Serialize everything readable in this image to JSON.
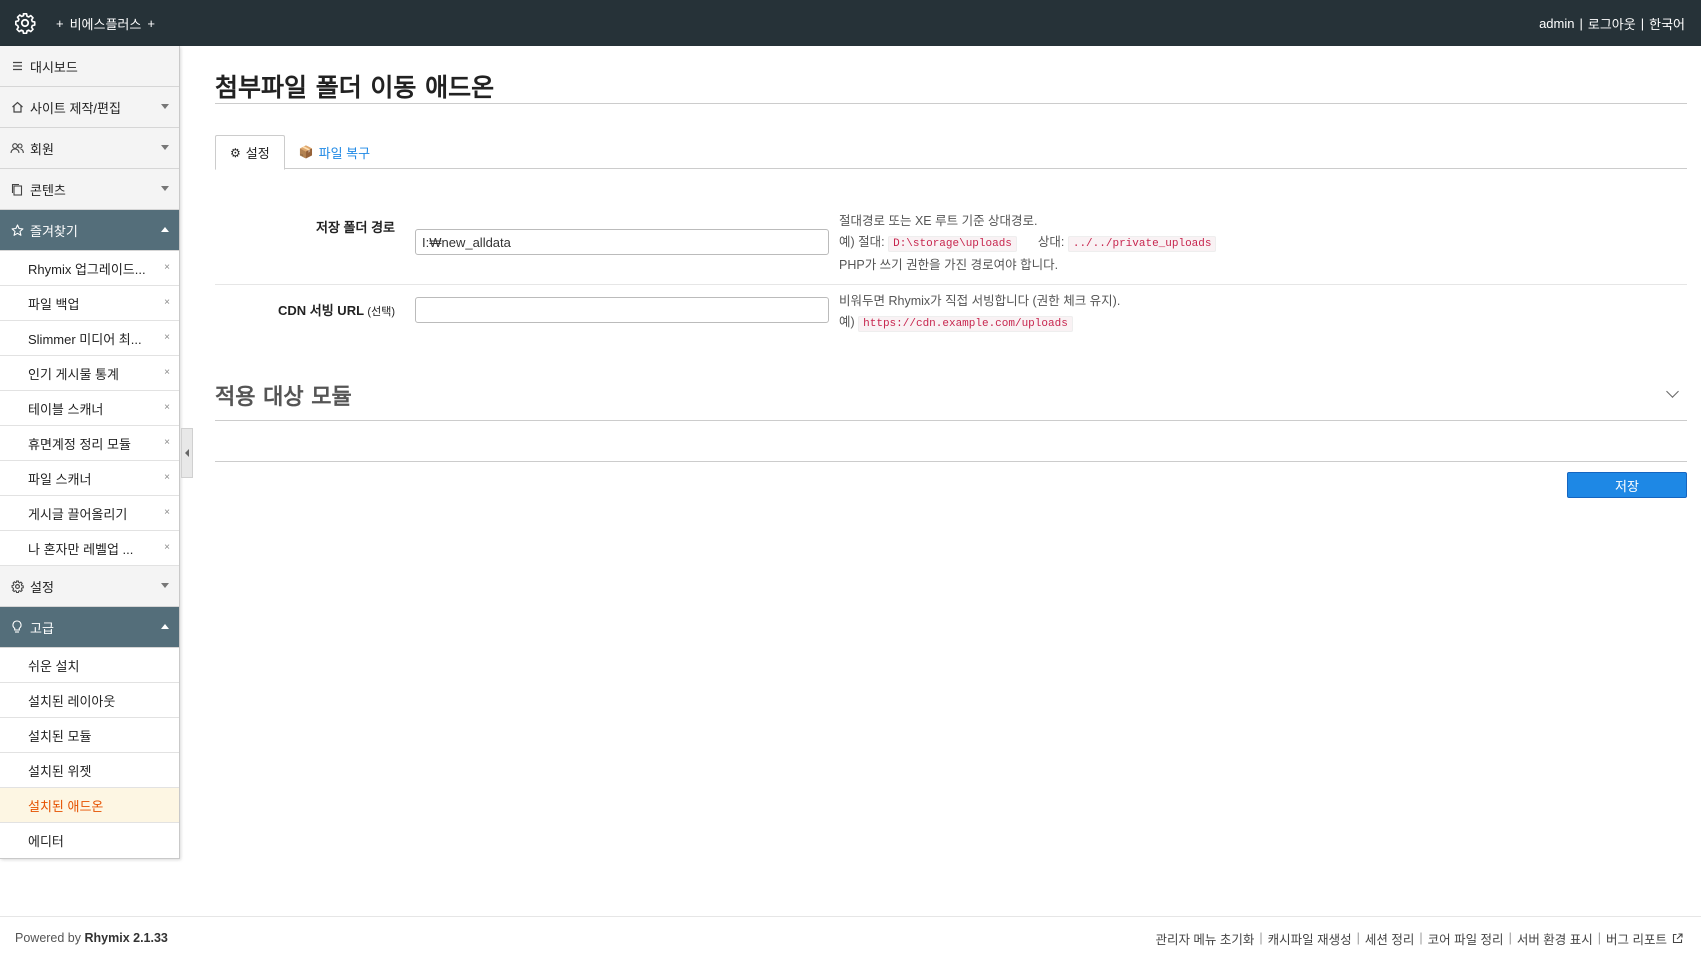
{
  "topbar": {
    "plus_left": "+",
    "site_name": "비에스플러스",
    "plus_right": "+",
    "user": "admin",
    "sep": "|",
    "logout": "로그아웃",
    "language": "한국어"
  },
  "sidebar": {
    "dashboard": "대시보드",
    "site": "사이트 제작/편집",
    "member": "회원",
    "content": "콘텐츠",
    "favorites": {
      "label": "즐겨찾기",
      "items": [
        {
          "label": "Rhymix 업그레이드...",
          "remove": "×"
        },
        {
          "label": "파일 백업",
          "remove": "×"
        },
        {
          "label": "Slimmer 미디어 최...",
          "remove": "×"
        },
        {
          "label": "인기 게시물 통계",
          "remove": "×"
        },
        {
          "label": "테이블 스캐너",
          "remove": "×"
        },
        {
          "label": "휴면계정 정리 모듈",
          "remove": "×"
        },
        {
          "label": "파일 스캐너",
          "remove": "×"
        },
        {
          "label": "게시글 끌어올리기",
          "remove": "×"
        },
        {
          "label": "나 혼자만 레벨업 ...",
          "remove": "×"
        }
      ]
    },
    "settings": "설정",
    "advanced": {
      "label": "고급",
      "items": [
        "쉬운 설치",
        "설치된 레이아웃",
        "설치된 모듈",
        "설치된 위젯",
        "설치된 애드온",
        "에디터"
      ]
    },
    "active_item": "설치된 애드온"
  },
  "main": {
    "title": "첨부파일 폴더 이동 애드온",
    "tabs": [
      {
        "icon": "⚙",
        "label": "설정"
      },
      {
        "icon": "📦",
        "label": "파일 복구"
      }
    ],
    "storage": {
      "label": "저장 폴더 경로",
      "value": "I:₩new_alldata",
      "help_line1": "절대경로 또는 XE 루트 기준 상대경로.",
      "help_abs_prefix": "예) 절대:",
      "help_abs_code": "D:\\storage\\uploads",
      "help_rel_prefix": "상대:",
      "help_rel_code": "../../private_uploads",
      "help_line3": "PHP가 쓰기 권한을 가진 경로여야 합니다."
    },
    "cdn": {
      "label": "CDN 서빙 URL",
      "label_small": "(선택)",
      "value": "",
      "help_line1": "비워두면 Rhymix가 직접 서빙합니다 (권한 체크 유지).",
      "help_ex_prefix": "예)",
      "help_ex_code": "https://cdn.example.com/uploads"
    },
    "section_title": "적용 대상 모듈",
    "save_label": "저장"
  },
  "footer": {
    "powered_prefix": "Powered by",
    "powered_brand": "Rhymix 2.1.33",
    "sep": "|",
    "links": [
      "관리자 메뉴 초기화",
      "캐시파일 재생성",
      "세션 정리",
      "코어 파일 정리",
      "서버 환경 표시",
      "버그 리포트"
    ]
  },
  "colors": {
    "topbar": "#263238",
    "open_menu": "#546e7a",
    "accent": "#1e88e5",
    "active_item_text": "#e65100"
  }
}
